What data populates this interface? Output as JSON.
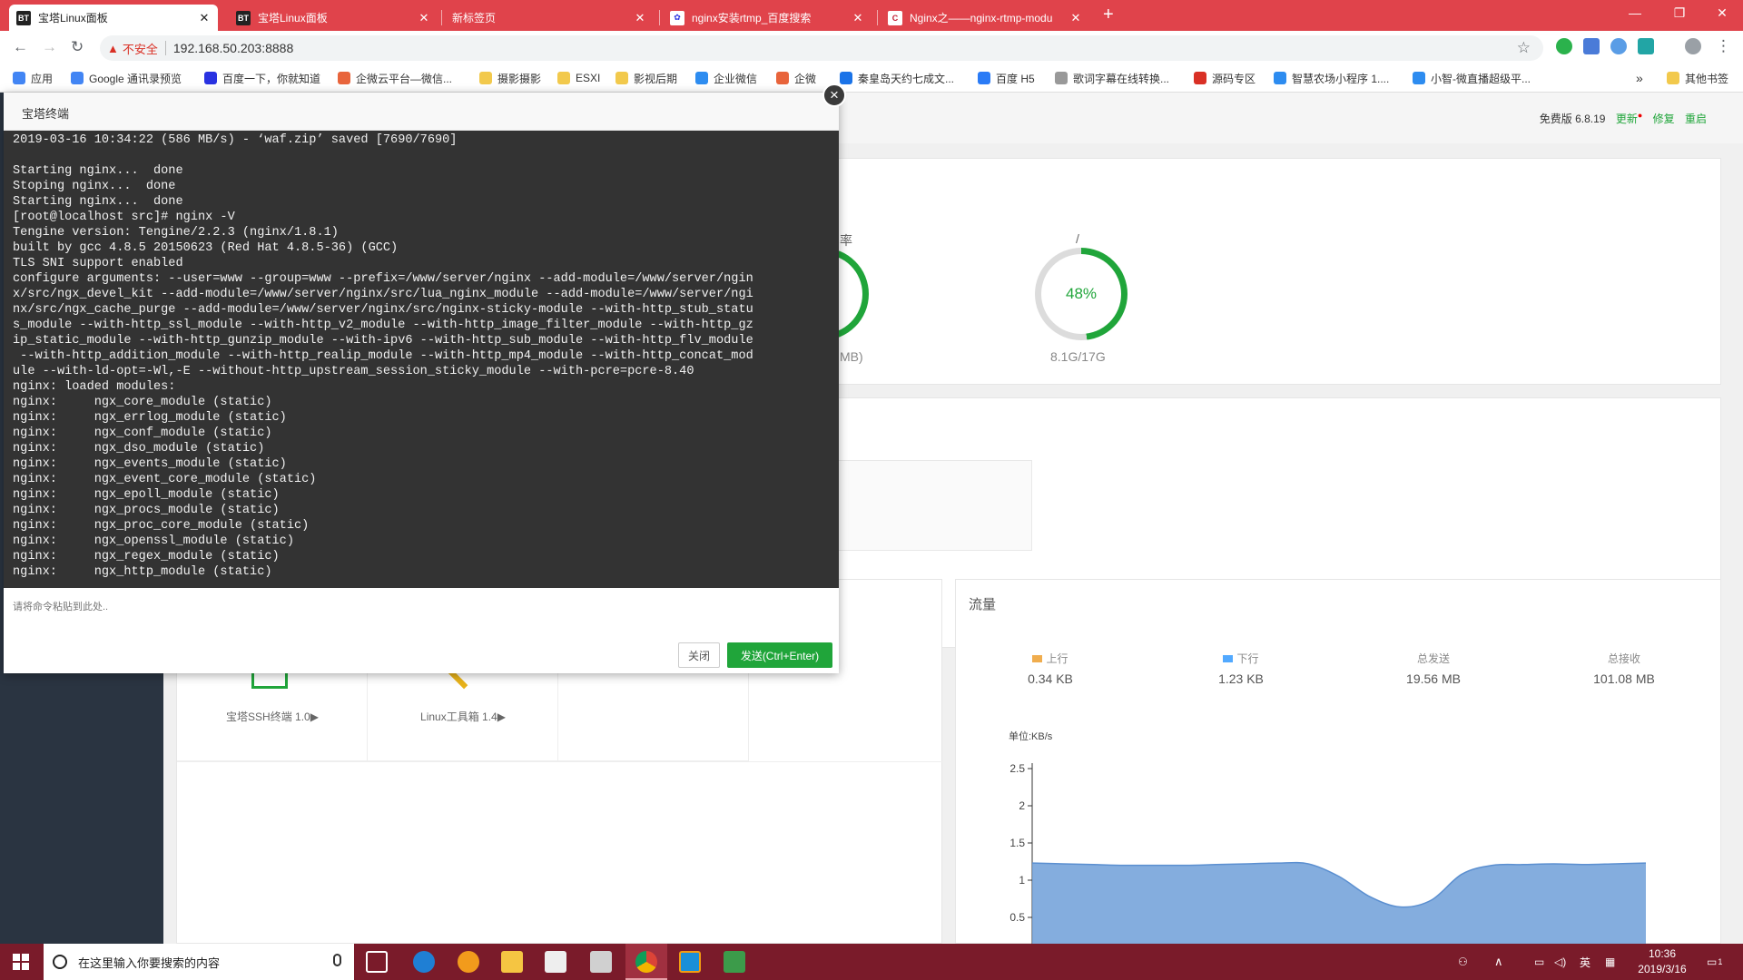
{
  "tabs": [
    {
      "favicon": "BT",
      "title": "宝塔Linux面板",
      "active": true
    },
    {
      "favicon": "BT",
      "title": "宝塔Linux面板",
      "active": false
    },
    {
      "favicon": "",
      "title": "新标签页",
      "active": false
    },
    {
      "favicon": "paw",
      "title": "nginx安装rtmp_百度搜索",
      "active": false
    },
    {
      "favicon": "C",
      "title": "Nginx之——nginx-rtmp-modu",
      "active": false
    }
  ],
  "address": {
    "security_label": "不安全",
    "url": "192.168.50.203:8888"
  },
  "bookmarks": [
    {
      "icon": "apps-icon",
      "label": "应用",
      "color": "#4285f4"
    },
    {
      "icon": "google-icon",
      "label": "Google 通讯录预览",
      "color": "#4285f4"
    },
    {
      "icon": "baidu-icon",
      "label": "百度一下，你就知道",
      "color": "#2932e1"
    },
    {
      "icon": "weixin-icon",
      "label": "企微云平台—微信...",
      "color": "#e8643b"
    },
    {
      "icon": "folder-icon",
      "label": "摄影摄影",
      "color": "#f2c94c"
    },
    {
      "icon": "folder-icon",
      "label": "ESXI",
      "color": "#f2c94c"
    },
    {
      "icon": "folder-icon",
      "label": "影视后期",
      "color": "#f2c94c"
    },
    {
      "icon": "wechat-work-icon",
      "label": "企业微信",
      "color": "#2d8cf0"
    },
    {
      "icon": "qiwei-icon",
      "label": "企微",
      "color": "#e8643b"
    },
    {
      "icon": "qhd-icon",
      "label": "秦皇岛天约七成文...",
      "color": "#1a73e8"
    },
    {
      "icon": "h5-icon",
      "label": "百度 H5",
      "color": "#2a7bf6"
    },
    {
      "icon": "doc-icon",
      "label": "歌词字幕在线转换...",
      "color": "#999999"
    },
    {
      "icon": "source-icon",
      "label": "源码专区",
      "color": "#d93025"
    },
    {
      "icon": "miniapp-icon",
      "label": "智慧农场小程序 1....",
      "color": "#2d8cf0"
    },
    {
      "icon": "xiaozhi-icon",
      "label": "小智-微直播超级平...",
      "color": "#2d8cf0"
    }
  ],
  "bookmarks_more": "»",
  "bookmarks_other": "其他书签",
  "panel_header": {
    "version": "免费版 6.8.19",
    "update": "更新",
    "repair": "修复",
    "restart": "重启"
  },
  "status": {
    "partial_label": "率",
    "partial_value": "MB)",
    "disk_label": "/",
    "disk_percent": "48%",
    "disk_value": 48,
    "disk_usage": "8.1G/17G",
    "colors": {
      "accent": "#20a53a",
      "ring_bg": "#dcdcdc"
    }
  },
  "software": [
    {
      "name": "宝塔SSH终端 1.0▶"
    },
    {
      "name": "Linux工具箱 1.4▶"
    }
  ],
  "traffic": {
    "title": "流量",
    "stats": [
      {
        "label": "上行",
        "value": "0.34 KB",
        "color": "#f0ad4e"
      },
      {
        "label": "下行",
        "value": "1.23 KB",
        "color": "#52a9ff"
      },
      {
        "label": "总发送",
        "value": "19.56 MB",
        "color": ""
      },
      {
        "label": "总接收",
        "value": "101.08 MB",
        "color": ""
      }
    ],
    "unit": "单位:KB/s"
  },
  "chart_data": {
    "type": "area",
    "title": "",
    "ylabel": "单位:KB/s",
    "ylim": [
      0.5,
      2.5
    ],
    "yticks": [
      2.5,
      2,
      1.5,
      1,
      0.5
    ],
    "x": [
      0,
      1,
      2,
      3,
      4,
      5,
      6,
      7,
      8,
      9,
      10,
      11,
      12,
      13,
      14,
      15,
      16,
      17,
      18,
      19,
      20
    ],
    "series": [
      {
        "values": [
          1.23,
          1.22,
          1.21,
          1.2,
          1.2,
          1.2,
          1.21,
          1.22,
          1.23,
          1.22,
          1.05,
          0.78,
          0.64,
          0.73,
          1.08,
          1.2,
          1.21,
          1.22,
          1.21,
          1.22,
          1.23
        ],
        "color": "#6f9fd8"
      }
    ]
  },
  "terminal": {
    "title": "宝塔终端",
    "lines": [
      "2019-03-16 10:34:22 (586 MB/s) - ‘waf.zip’ saved [7690/7690]",
      "",
      "Starting nginx...  done",
      "Stoping nginx...  done",
      "Starting nginx...  done",
      "[root@localhost src]# nginx -V",
      "Tengine version: Tengine/2.2.3 (nginx/1.8.1)",
      "built by gcc 4.8.5 20150623 (Red Hat 4.8.5-36) (GCC)",
      "TLS SNI support enabled",
      "configure arguments: --user=www --group=www --prefix=/www/server/nginx --add-module=/www/server/ngin",
      "x/src/ngx_devel_kit --add-module=/www/server/nginx/src/lua_nginx_module --add-module=/www/server/ngi",
      "nx/src/ngx_cache_purge --add-module=/www/server/nginx/src/nginx-sticky-module --with-http_stub_statu",
      "s_module --with-http_ssl_module --with-http_v2_module --with-http_image_filter_module --with-http_gz",
      "ip_static_module --with-http_gunzip_module --with-ipv6 --with-http_sub_module --with-http_flv_module",
      " --with-http_addition_module --with-http_realip_module --with-http_mp4_module --with-http_concat_mod",
      "ule --with-ld-opt=-Wl,-E --without-http_upstream_session_sticky_module --with-pcre=pcre-8.40",
      "nginx: loaded modules:",
      "nginx:     ngx_core_module (static)",
      "nginx:     ngx_errlog_module (static)",
      "nginx:     ngx_conf_module (static)",
      "nginx:     ngx_dso_module (static)",
      "nginx:     ngx_events_module (static)",
      "nginx:     ngx_event_core_module (static)",
      "nginx:     ngx_epoll_module (static)",
      "nginx:     ngx_procs_module (static)",
      "nginx:     ngx_proc_core_module (static)",
      "nginx:     ngx_openssl_module (static)",
      "nginx:     ngx_regex_module (static)",
      "nginx:     ngx_http_module (static)"
    ],
    "input_placeholder": "请将命令粘贴到此处..",
    "close_label": "关闭",
    "send_label": "发送(Ctrl+Enter)"
  },
  "taskbar": {
    "search_placeholder": "在这里输入你要搜索的内容",
    "time": "10:36",
    "date": "2019/3/16",
    "ime": "英",
    "notif_count": "1"
  }
}
